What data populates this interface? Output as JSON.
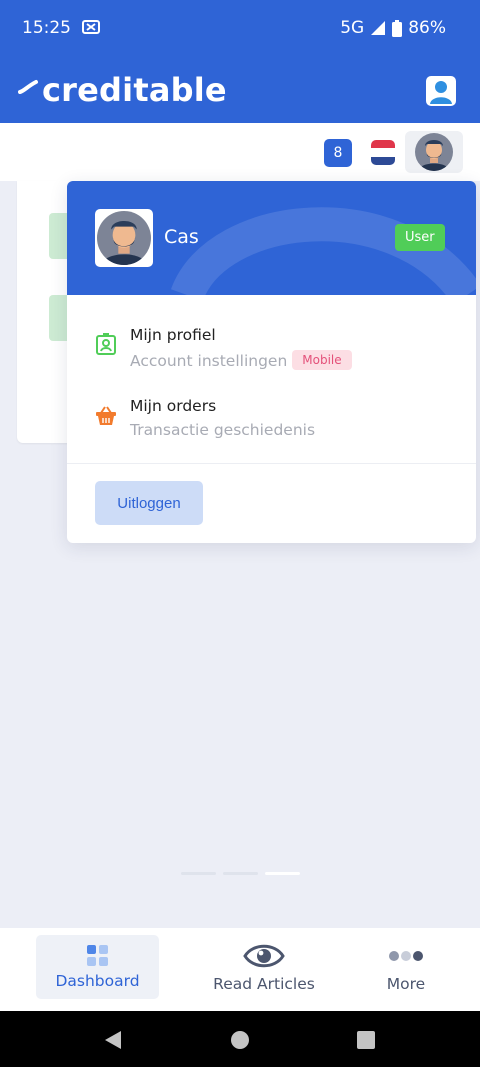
{
  "status_bar": {
    "time": "15:25",
    "network": "5G",
    "battery": "86%"
  },
  "app": {
    "logo_text": "creditable",
    "brand_color": "#2f64d6"
  },
  "toolbar": {
    "notification_count": "8",
    "language": "NL"
  },
  "profile_menu": {
    "user_name": "Cas",
    "role_badge": "User",
    "items": [
      {
        "title": "Mijn profiel",
        "subtitle": "Account instellingen",
        "tag": "Mobile",
        "icon": "profile-card-icon"
      },
      {
        "title": "Mijn orders",
        "subtitle": "Transactie geschiedenis",
        "icon": "basket-icon"
      }
    ],
    "logout_label": "Uitloggen"
  },
  "bottom_nav": {
    "items": [
      {
        "label": "Dashboard",
        "icon": "dashboard-grid-icon",
        "active": true
      },
      {
        "label": "Read Articles",
        "icon": "eye-icon",
        "active": false
      },
      {
        "label": "More",
        "icon": "more-dots-icon",
        "active": false
      }
    ]
  },
  "colors": {
    "accent": "#2f64d6",
    "success": "#50cd58",
    "danger_light": "#fcdee4",
    "danger": "#e4517a"
  }
}
